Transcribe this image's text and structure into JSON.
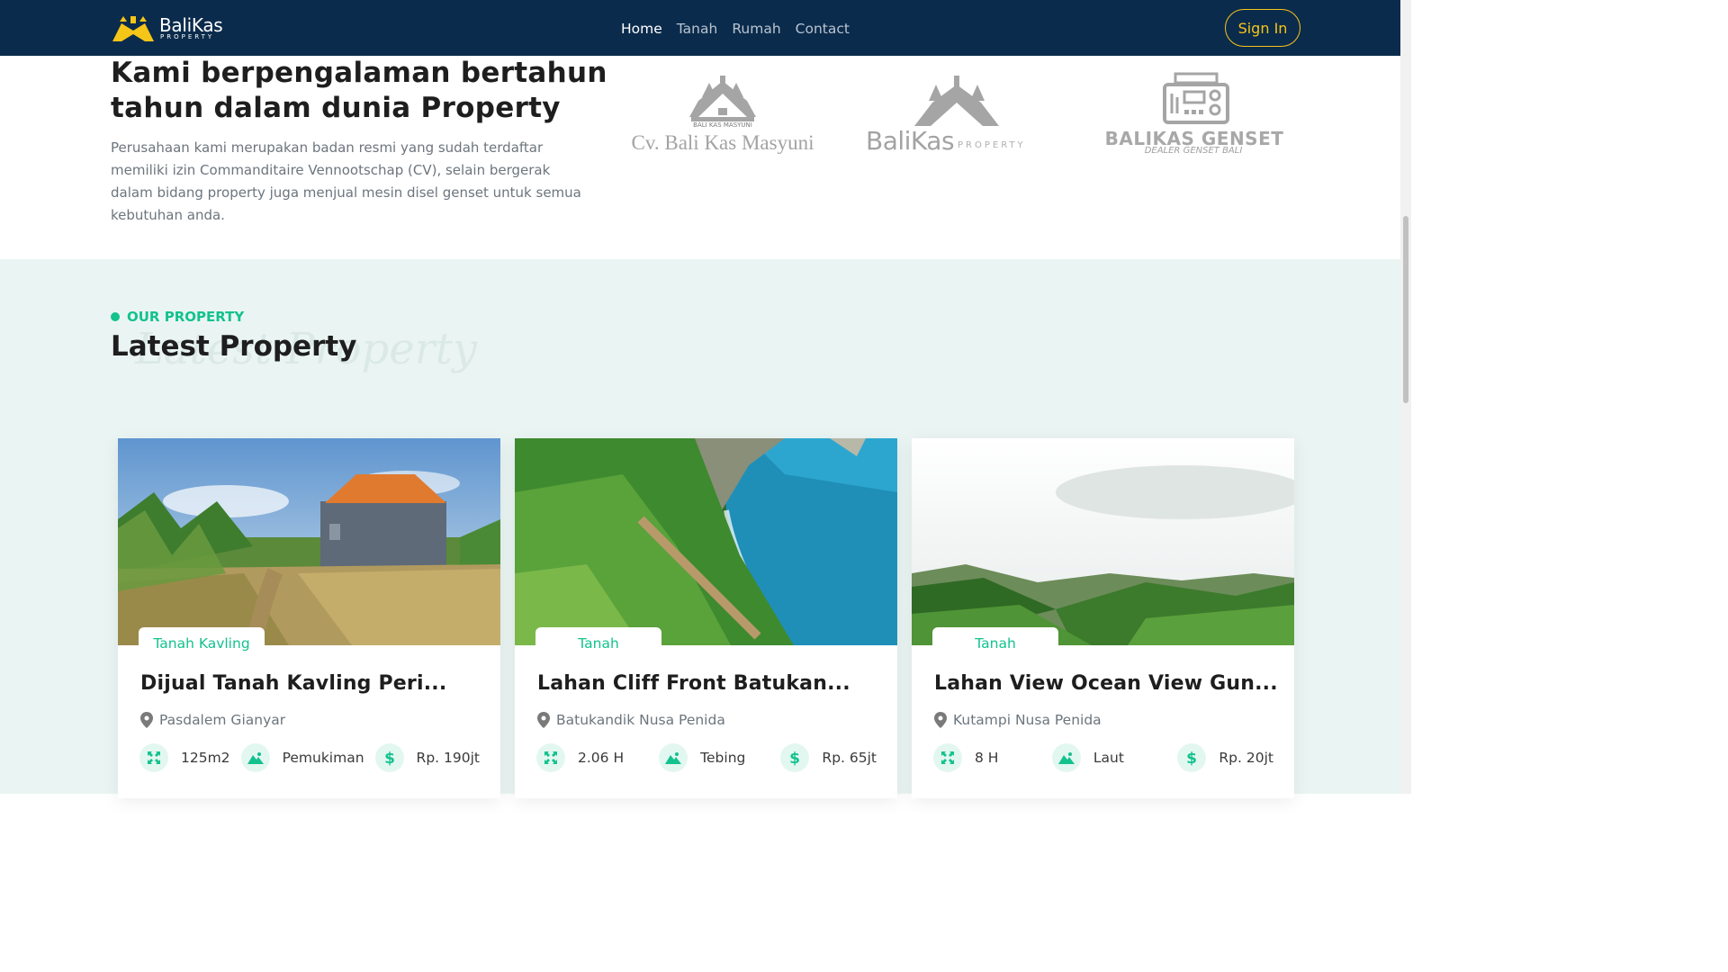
{
  "navbar": {
    "brand_name": "BaliKas",
    "brand_sub": "PROPERTY",
    "links": [
      "Home",
      "Tanah",
      "Rumah",
      "Contact"
    ],
    "signin_label": "Sign In"
  },
  "about": {
    "title": "Kami berpengalaman bertahun tahun dalam dunia Property",
    "description": "Perusahaan kami merupakan badan resmi yang sudah terdaftar memiliki izin Commanditaire Vennootschap (CV), selain bergerak dalam bidang property juga menjual mesin disel genset untuk semua kebutuhan anda.",
    "logos": [
      {
        "name": "Cv. Bali Kas Masyuni",
        "small": "BALI KAS MASYUNI"
      },
      {
        "name": "BaliKas",
        "sub": "PROPERTY"
      },
      {
        "name": "BALIKAS GENSET",
        "sub": "DEALER GENSET BALI"
      }
    ]
  },
  "properties": {
    "eyebrow": "OUR PROPERTY",
    "title": "Latest Property",
    "watermark": "Latest Property",
    "cards": [
      {
        "tag": "Tanah Kavling",
        "title": "Dijual Tanah Kavling Peri...",
        "location": "Pasdalem Gianyar",
        "area": "125m2",
        "type": "Pemukiman",
        "price": "Rp. 190jt"
      },
      {
        "tag": "Tanah",
        "title": "Lahan Cliff Front Batukan...",
        "location": "Batukandik Nusa Penida",
        "area": "2.06 H",
        "type": "Tebing",
        "price": "Rp. 65jt"
      },
      {
        "tag": "Tanah",
        "title": "Lahan View Ocean View Gun...",
        "location": "Kutampi Nusa Penida",
        "area": "8 H",
        "type": "Laut",
        "price": "Rp. 20jt"
      }
    ]
  },
  "colors": {
    "navy": "#0b2b4c",
    "accent": "#13c28d",
    "gold": "#f5c518"
  }
}
